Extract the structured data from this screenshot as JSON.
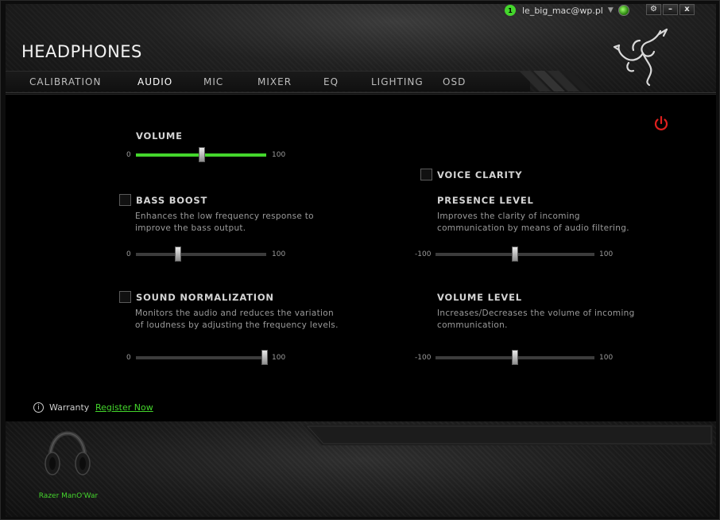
{
  "window": {
    "title": "HEADPHONES",
    "controls": {
      "settings": "⚙",
      "minimize": "–",
      "close": "x"
    }
  },
  "account": {
    "notifications": "1",
    "email": "le_big_mac@wp.pl",
    "dropdown_icon": "▼"
  },
  "nav": {
    "tabs": [
      {
        "label": "CALIBRATION",
        "active": false
      },
      {
        "label": "AUDIO",
        "active": true
      },
      {
        "label": "MIC",
        "active": false
      },
      {
        "label": "MIXER",
        "active": false
      },
      {
        "label": "EQ",
        "active": false
      },
      {
        "label": "LIGHTING",
        "active": false
      },
      {
        "label": "OSD",
        "active": false
      }
    ]
  },
  "audio": {
    "volume": {
      "label": "VOLUME",
      "min": "0",
      "max": "100",
      "value": 50
    },
    "bass_boost": {
      "label": "BASS BOOST",
      "checked": false,
      "description_line1": "Enhances the low frequency response to",
      "description_line2": "improve the bass output.",
      "min": "0",
      "max": "100",
      "value": 32
    },
    "sound_normalization": {
      "label": "SOUND NORMALIZATION",
      "checked": false,
      "description_line1": "Monitors the audio and reduces the variation",
      "description_line2": "of loudness by adjusting the frequency levels.",
      "min": "0",
      "max": "100",
      "value": 100
    },
    "voice_clarity": {
      "label": "VOICE CLARITY",
      "checked": false
    },
    "presence_level": {
      "label": "PRESENCE LEVEL",
      "description_line1": "Improves the clarity of incoming",
      "description_line2": "communication by means of audio filtering.",
      "min": "-100",
      "max": "100",
      "value": 0
    },
    "volume_level": {
      "label": "VOLUME LEVEL",
      "description_line1": "Increases/Decreases the volume of incoming",
      "description_line2": "communication.",
      "min": "-100",
      "max": "100",
      "value": 0
    }
  },
  "warranty": {
    "label": "Warranty",
    "link": "Register Now",
    "icon": "i"
  },
  "device": {
    "name": "Razer ManO'War"
  },
  "colors": {
    "accent": "#44d62c",
    "power": "#e0201e"
  }
}
